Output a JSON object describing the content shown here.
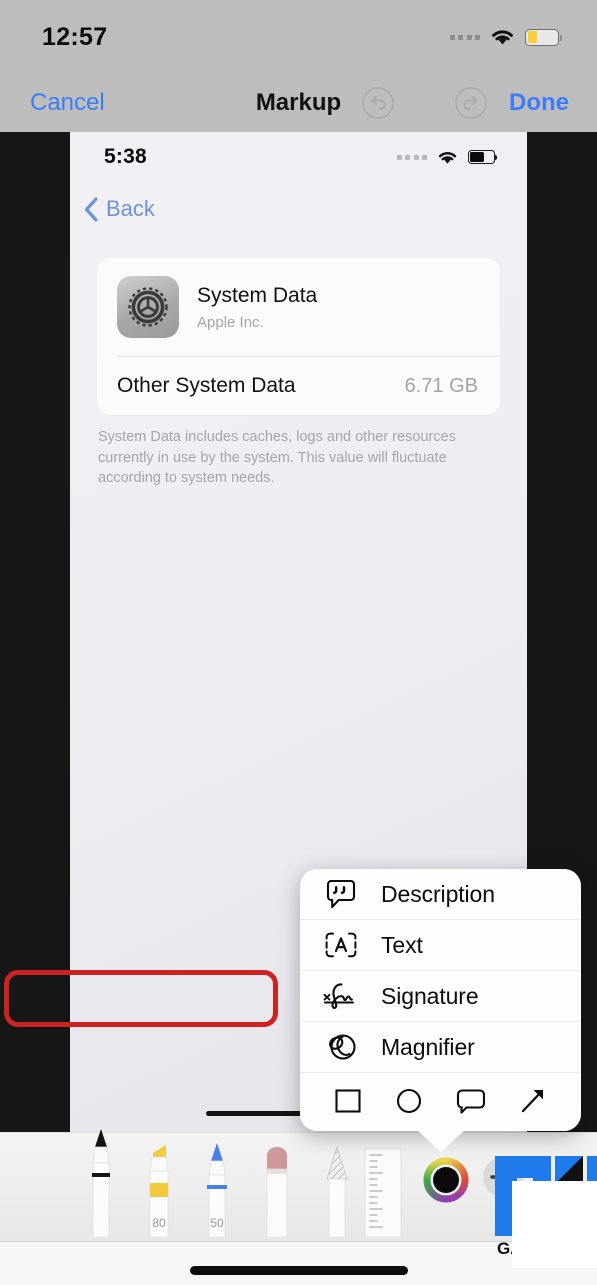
{
  "outer_status": {
    "clock": "12:57",
    "signal_icon": "cellular-signal-icon",
    "wifi_icon": "wifi-icon",
    "battery_icon": "battery-low-power-icon",
    "battery_color": "#f7cf34"
  },
  "markup_header": {
    "cancel_label": "Cancel",
    "title": "Markup",
    "undo_icon": "undo-icon",
    "redo_icon": "redo-icon",
    "done_label": "Done",
    "accent_color": "#3b7df6",
    "bar_color": "#bdbdbd"
  },
  "inner_screenshot": {
    "status": {
      "clock": "5:38",
      "signal_icon": "cellular-signal-icon",
      "wifi_icon": "wifi-icon",
      "battery_icon": "battery-icon"
    },
    "nav": {
      "back_label": "Back",
      "back_icon": "chevron-left-icon"
    },
    "card": {
      "app_icon": "settings-gear-icon",
      "app_name": "System Data",
      "app_developer": "Apple Inc.",
      "row_label": "Other System Data",
      "row_value": "6.71 GB"
    },
    "footnote": "System Data includes caches, logs and other resources currently in use by the system. This value will fluctuate according to system needs."
  },
  "popup_menu": {
    "items": [
      {
        "label": "Description",
        "icon": "speech-bubble-quote-icon"
      },
      {
        "label": "Text",
        "icon": "text-box-a-icon"
      },
      {
        "label": "Signature",
        "icon": "signature-icon"
      },
      {
        "label": "Magnifier",
        "icon": "magnifier-icon"
      }
    ],
    "shapes": [
      {
        "name": "square-shape-icon"
      },
      {
        "name": "circle-shape-icon"
      },
      {
        "name": "speech-bubble-shape-icon"
      },
      {
        "name": "arrow-shape-icon"
      }
    ],
    "highlight": {
      "target_label": "Signature",
      "color": "#cc2222"
    }
  },
  "tool_tray": {
    "tools": [
      {
        "name": "pen-tool",
        "label": "",
        "color": "#141414"
      },
      {
        "name": "highlighter-tool",
        "label": "80",
        "color": "#f3c93f"
      },
      {
        "name": "marker-tool",
        "label": "50",
        "color": "#4a7fe8"
      },
      {
        "name": "eraser-tool",
        "label": "",
        "color": "#cf9898"
      },
      {
        "name": "lasso-tool",
        "label": "",
        "color": "#c9c9c9"
      },
      {
        "name": "ruler-tool",
        "label": "",
        "color": "#d6d6d6"
      }
    ],
    "color_wheel_icon": "color-wheel-icon",
    "add_button_icon": "plus-button-icon"
  },
  "watermark": {
    "text": "GAD"
  }
}
